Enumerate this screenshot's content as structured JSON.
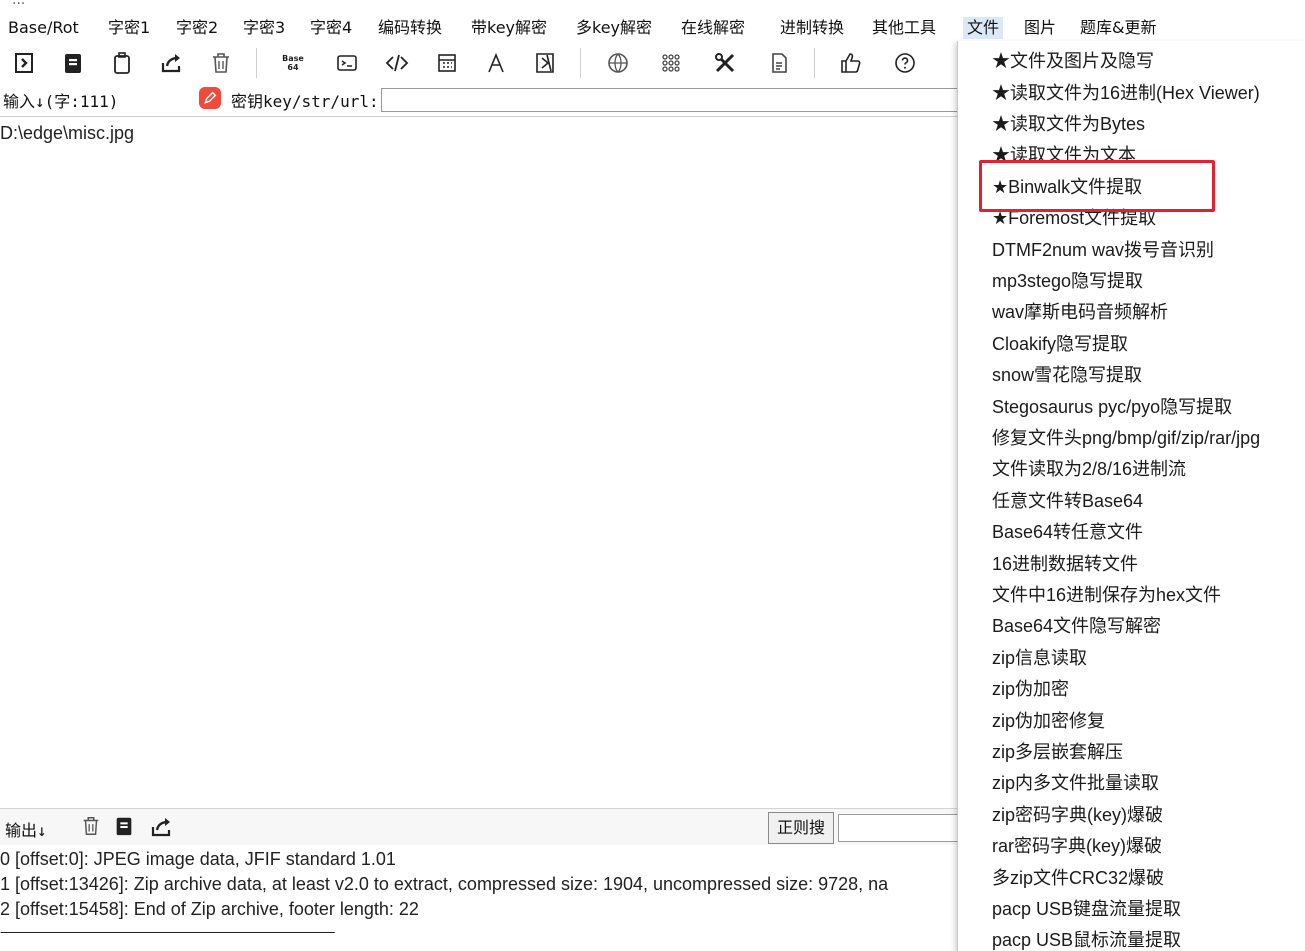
{
  "window": {
    "title_fragment": "..."
  },
  "menubar": {
    "items": [
      "Base/Rot",
      "字密1",
      "字密2",
      "字密3",
      "字密4",
      "编码转换",
      "带key解密",
      "多key解密",
      "在线解密",
      "进制转换",
      "其他工具",
      "文件",
      "图片",
      "题库&更新"
    ]
  },
  "toolbar": {
    "icons": [
      "import-icon",
      "copy-icon",
      "paste-icon",
      "share-icon",
      "trash-icon",
      "base64-icon",
      "terminal-icon",
      "code-icon",
      "calculator-icon",
      "font-icon",
      "script-icon",
      "globe-icon",
      "grid-icon",
      "tools-icon",
      "document-icon",
      "thumbs-up-icon",
      "help-icon"
    ],
    "base64_text": "Base\n64"
  },
  "input": {
    "label": "输入↓(字:111)",
    "key_label": "密钥key/str/url:",
    "key_value": "",
    "content": "D:\\edge\\misc.jpg"
  },
  "output": {
    "label": "输出↓",
    "regex_button": "正则搜",
    "lines": [
      "0 [offset:0]: JPEG image data, JFIF standard 1.01",
      "1 [offset:13426]: Zip archive data, at least v2.0 to extract, compressed size: 1904, uncompressed size: 9728, na",
      "2 [offset:15458]: End of Zip archive, footer length: 22",
      "----------------------------------------------------------------------------------------------------------------------"
    ]
  },
  "file_menu": {
    "items": [
      "★文件及图片及隐写",
      "★读取文件为16进制(Hex Viewer)",
      "★读取文件为Bytes",
      "★读取文件为文本",
      "★Binwalk文件提取",
      "★Foremost文件提取",
      "DTMF2num  wav拨号音识别",
      "mp3stego隐写提取",
      "wav摩斯电码音频解析",
      "Cloakify隐写提取",
      "snow雪花隐写提取",
      "Stegosaurus pyc/pyo隐写提取",
      "修复文件头png/bmp/gif/zip/rar/jpg",
      "文件读取为2/8/16进制流",
      "任意文件转Base64",
      "Base64转任意文件",
      "16进制数据转文件",
      "文件中16进制保存为hex文件",
      "Base64文件隐写解密",
      "zip信息读取",
      "zip伪加密",
      "zip伪加密修复",
      "zip多层嵌套解压",
      "zip内多文件批量读取",
      "zip密码字典(key)爆破",
      "rar密码字典(key)爆破",
      "多zip文件CRC32爆破",
      "pacp USB键盘流量提取",
      "pacp USB鼠标流量提取"
    ],
    "highlighted": "★Binwalk文件提取",
    "highlight_color": "#e3202f"
  }
}
